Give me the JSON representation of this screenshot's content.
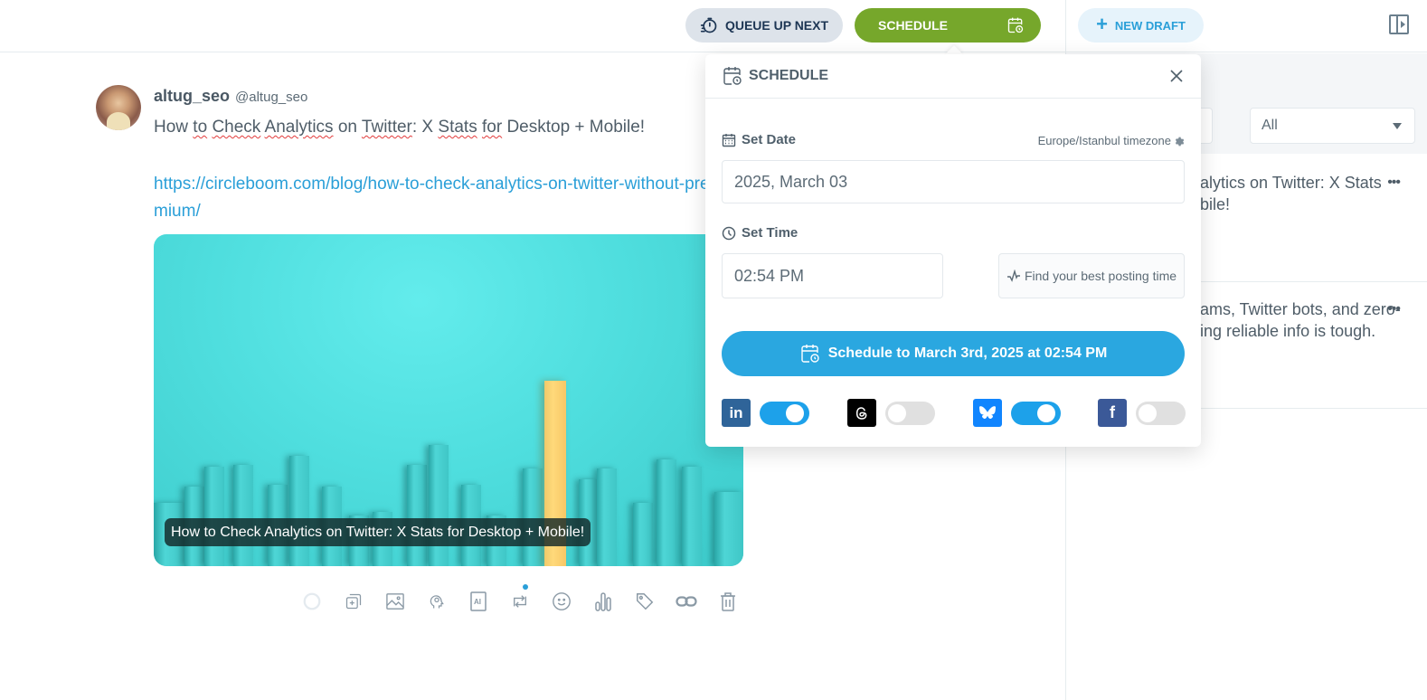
{
  "topbar": {
    "queue_label": "QUEUE UP NEXT",
    "schedule_label": "SCHEDULE",
    "new_draft_label": "NEW DRAFT"
  },
  "post": {
    "name": "altug_seo",
    "handle": "@altug_seo",
    "text_parts": [
      "How ",
      "to",
      " ",
      "Check",
      " ",
      "Analytics",
      " on ",
      "Twitter",
      ": X ",
      "Stats",
      " ",
      "for",
      " Desktop + Mobile!"
    ],
    "link": "https://circleboom.com/blog/how-to-check-analytics-on-twitter-without-premium/",
    "image_caption": "How to Check Analytics on Twitter: X Stats for Desktop + Mobile!"
  },
  "toolbar": {
    "icons": [
      "loading-spinner-icon",
      "add-thread-icon",
      "image-icon",
      "ai-brain-icon",
      "ai-text-icon",
      "repost-icon",
      "emoji-icon",
      "poll-icon",
      "tag-icon",
      "link-icon",
      "trash-icon"
    ]
  },
  "sidebar": {
    "filter_value": "All",
    "drafts": [
      {
        "text_line1": "alytics on Twitter: X Stats",
        "text_line2": "bile!"
      },
      {
        "text_line1": "ams, Twitter bots, and zero-",
        "text_line2": "ing reliable info is tough."
      }
    ]
  },
  "schedule_popover": {
    "title": "SCHEDULE",
    "set_date_label": "Set Date",
    "timezone": "Europe/Istanbul timezone",
    "date_value": "2025, March 03",
    "set_time_label": "Set Time",
    "time_value": "02:54 PM",
    "best_time_label": "Find your best posting time",
    "cta_label": "Schedule to March 3rd, 2025 at 02:54 PM",
    "networks": [
      {
        "name": "LinkedIn",
        "icon": "linkedin-icon",
        "enabled": true,
        "color": "#2f6499"
      },
      {
        "name": "Threads",
        "icon": "threads-icon",
        "enabled": false,
        "color": "#000000"
      },
      {
        "name": "Bluesky",
        "icon": "bluesky-icon",
        "enabled": true,
        "color": "#1185fe"
      },
      {
        "name": "Facebook",
        "icon": "facebook-icon",
        "enabled": false,
        "color": "#3b5998"
      }
    ]
  },
  "colors": {
    "schedule_green": "#76a72b",
    "accent_blue": "#2aa7e0",
    "queue_bg": "#dde3ea",
    "toggle_on": "#1da1ea"
  }
}
